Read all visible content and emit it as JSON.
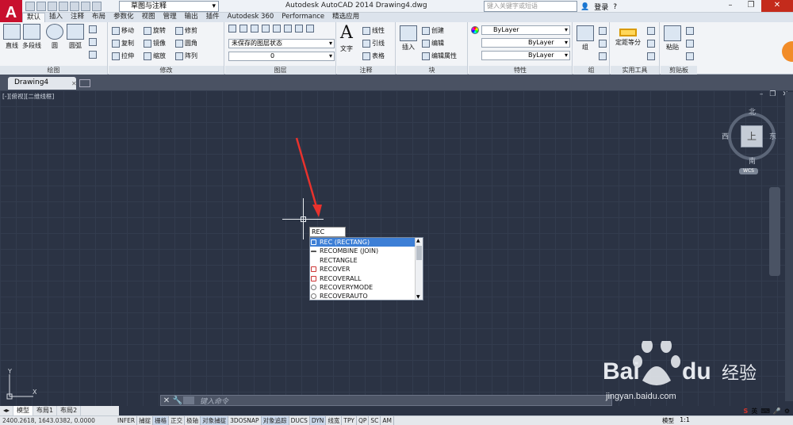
{
  "titlebar": {
    "app_logo": "A",
    "workspace": "草图与注释",
    "title": "Autodesk AutoCAD 2014    Drawing4.dwg",
    "search_placeholder": "键入关键字或短语",
    "login": "登录"
  },
  "ribbon_tabs": [
    "默认",
    "插入",
    "注释",
    "布局",
    "参数化",
    "视图",
    "管理",
    "输出",
    "插件",
    "Autodesk 360",
    "Performance",
    "精选应用"
  ],
  "panels": {
    "draw": {
      "title": "绘图",
      "line": "直线",
      "polyline": "多段线",
      "circle": "圆",
      "arc": "圆弧"
    },
    "modify": {
      "title": "修改",
      "move": "移动",
      "rotate": "旋转",
      "trim": "修剪",
      "copy": "复制",
      "mirror": "镜像",
      "fillet": "圆角",
      "stretch": "拉伸",
      "scale": "缩放",
      "array": "阵列"
    },
    "layers": {
      "title": "图层",
      "layer_state": "未保存的图层状态",
      "current_layer": "0"
    },
    "annotation": {
      "title": "注释",
      "text": "文字",
      "linear": "线性",
      "leader": "引线",
      "table": "表格"
    },
    "block": {
      "title": "块",
      "insert": "插入",
      "create": "创建",
      "edit": "编辑",
      "edit_attr": "编辑属性"
    },
    "properties": {
      "title": "特性",
      "color": "ByLayer",
      "linetype": "ByLayer",
      "lineweight": "ByLayer"
    },
    "groups": {
      "title": "组",
      "group": "组"
    },
    "utilities": {
      "title": "实用工具",
      "measure": "定距等分"
    },
    "clipboard": {
      "title": "剪贴板",
      "paste": "粘贴"
    }
  },
  "document_tab": "Drawing4",
  "canvas": {
    "view_label": "[-][俯视][二维线框]",
    "viewcube": {
      "north": "北",
      "south": "南",
      "east": "东",
      "west": "西",
      "face": "上",
      "wcs": "WCS"
    },
    "ucs_y": "Y",
    "ucs_x": "X"
  },
  "command": {
    "typed": "REC",
    "placeholder": "键入命令",
    "suggestions": [
      "REC (RECTANG)",
      "RECOMBINE (JOIN)",
      "RECTANGLE",
      "RECOVER",
      "RECOVERALL",
      "RECOVERYMODE",
      "RECOVERAUTO"
    ]
  },
  "layout_tabs": [
    "模型",
    "布局1",
    "布局2"
  ],
  "status": {
    "coords": "2400.2618, 1643.0382, 0.0000",
    "buttons": [
      "INFER",
      "捕捉",
      "栅格",
      "正交",
      "极轴",
      "对象捕捉",
      "3DOSNAP",
      "对象追踪",
      "DUCS",
      "DYN",
      "线宽",
      "TPY",
      "QP",
      "SC",
      "AM"
    ],
    "model": "模型",
    "scale": "1:1"
  },
  "watermark": {
    "text": "jingyan.baidu.com"
  }
}
